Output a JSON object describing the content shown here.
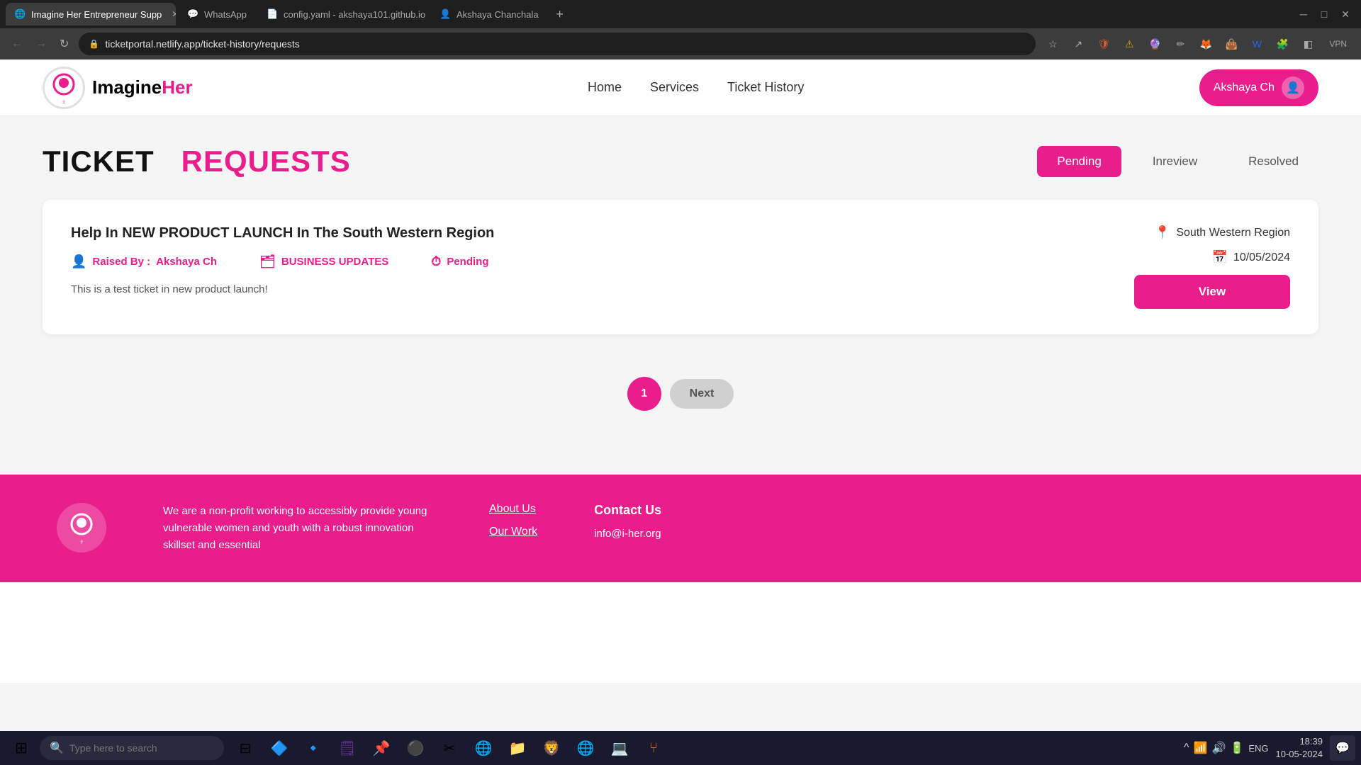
{
  "browser": {
    "tabs": [
      {
        "id": "tab-imagineer",
        "label": "Imagine Her Entrepreneur Supp",
        "favicon": "🌐",
        "active": true
      },
      {
        "id": "tab-whatsapp",
        "label": "WhatsApp",
        "favicon": "💬",
        "active": false
      },
      {
        "id": "tab-config",
        "label": "config.yaml - akshaya101.github.io",
        "favicon": "📄",
        "active": false
      },
      {
        "id": "tab-akshaya",
        "label": "Akshaya Chanchala",
        "favicon": "👤",
        "active": false
      }
    ],
    "url": "ticketportal.netlify.app/ticket-history/requests",
    "nav": {
      "back_disabled": true,
      "forward_disabled": true
    }
  },
  "navbar": {
    "brand": {
      "imagine": "Imagine",
      "her": "Her"
    },
    "links": [
      {
        "label": "Home",
        "id": "home"
      },
      {
        "label": "Services",
        "id": "services"
      },
      {
        "label": "Ticket History",
        "id": "ticket-history"
      }
    ],
    "user_button": "Akshaya Ch"
  },
  "page": {
    "title_part1": "TICKET",
    "title_part2": "REQUESTS",
    "filters": [
      {
        "label": "Pending",
        "active": true
      },
      {
        "label": "Inreview",
        "active": false
      },
      {
        "label": "Resolved",
        "active": false
      }
    ]
  },
  "tickets": [
    {
      "title": "Help In NEW PRODUCT LAUNCH In The South Western Region",
      "raised_by_label": "Raised By :",
      "raised_by": "Akshaya Ch",
      "category": "BUSINESS UPDATES",
      "status": "Pending",
      "description": "This is a test ticket in new product launch!",
      "location": "South Western Region",
      "date": "10/05/2024",
      "view_btn": "View"
    }
  ],
  "pagination": {
    "current_page": "1",
    "next_label": "Next"
  },
  "footer": {
    "description": "We are a non-profit working to accessibly provide young vulnerable women and youth with a robust innovation skillset and essential",
    "links": [
      {
        "label": "About Us"
      },
      {
        "label": "Our Work"
      }
    ],
    "contact_title": "Contact Us",
    "contact_email": "info@i-her.org"
  },
  "taskbar": {
    "search_placeholder": "Type here to search",
    "clock": "18:39",
    "date": "10-05-2024",
    "icons": [
      "⊞",
      "🔍",
      "📋",
      "🔲",
      "📧",
      "📝",
      "🟣",
      "🔲",
      "✂",
      "🌐",
      "📁",
      "🛡",
      "🌐",
      "💻",
      "📌"
    ]
  }
}
